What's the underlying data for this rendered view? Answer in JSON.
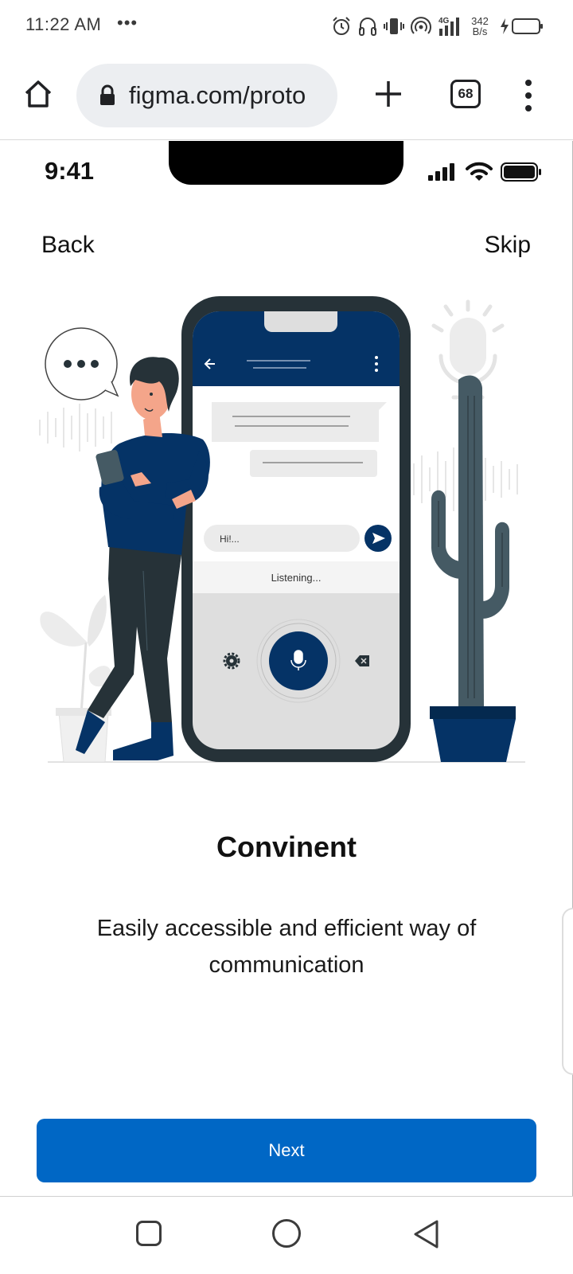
{
  "status_bar": {
    "time": "11:22 AM",
    "dots": "•••",
    "net_speed_value": "342",
    "net_speed_unit": "B/s",
    "network_type": "4G",
    "icons": [
      "alarm-icon",
      "headset-icon",
      "vibrate-icon",
      "hotspot-icon",
      "signal-4g-icon",
      "battery-charging-icon"
    ]
  },
  "browser": {
    "url": "figma.com/proto",
    "tab_count": "68",
    "icons": [
      "home-icon",
      "lock-icon",
      "new-tab-plus-icon",
      "tab-switcher-icon",
      "overflow-menu-icon"
    ]
  },
  "ios_status": {
    "time": "9:41",
    "icons": [
      "cellular-signal-icon",
      "wifi-icon",
      "battery-icon"
    ]
  },
  "onboarding": {
    "back_label": "Back",
    "skip_label": "Skip",
    "title": "Convinent",
    "subtitle": "Easily accessible and efficient way of communication",
    "next_label": "Next",
    "illustration": {
      "chat_input_text": "Hi!...",
      "listening_text": "Listening...",
      "icons": [
        "speech-bubble-icon",
        "back-arrow-icon",
        "kebab-menu-icon",
        "send-icon",
        "settings-gear-icon",
        "microphone-icon",
        "backspace-icon",
        "cactus-illustration",
        "plant-illustration",
        "person-illustration"
      ]
    }
  },
  "android_nav": {
    "icons": [
      "recents-square-icon",
      "home-circle-icon",
      "back-triangle-icon"
    ]
  },
  "colors": {
    "primary_button": "#0067c5",
    "navy": "#053366",
    "phone_frame": "#263238"
  }
}
